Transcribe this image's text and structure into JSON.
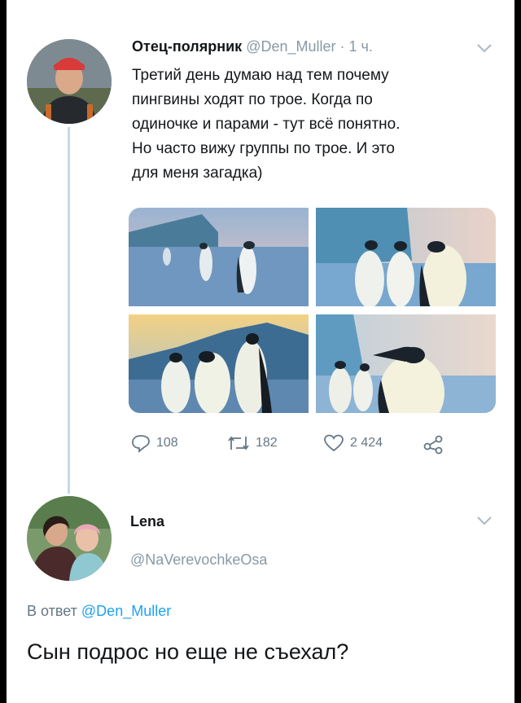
{
  "tweet": {
    "author_name": "Отец-полярник",
    "handle": "@Den_Muller",
    "separator": "·",
    "time": "1 ч.",
    "lines": [
      "Третий день думаю над тем почему",
      "пингвины ходят по трое. Когда по",
      "одиночке и парами - тут всё понятно.",
      "Но часто вижу группы по трое. И это",
      "для меня загадка)"
    ],
    "actions": {
      "replies": "108",
      "retweets": "182",
      "likes": "2 424"
    }
  },
  "reply_tweet": {
    "author_name": "Lena",
    "handle": "@NaVerevochkeOsa",
    "reply_prefix": "В ответ",
    "reply_to": "@Den_Muller",
    "text": "Сын подрос но еще не съехал?"
  },
  "colors": {
    "link": "#1da1f2",
    "muted": "#8899a6",
    "thread_line": "#c9d8e3"
  }
}
